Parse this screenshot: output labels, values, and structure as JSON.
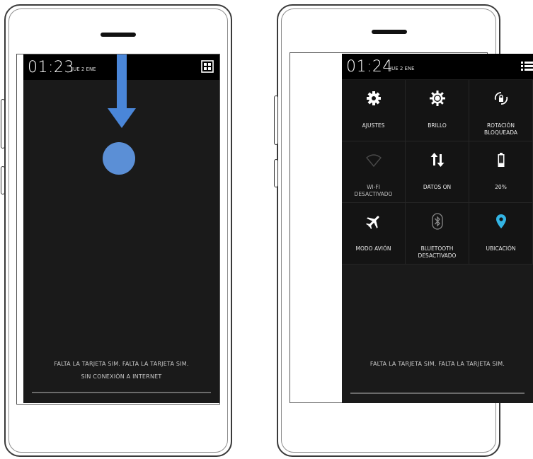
{
  "left_screen": {
    "time": "01:23",
    "date": "JUE 2 ENE",
    "notice_line1": "FALTA LA TARJETA SIM.   FALTA LA TARJETA SIM.",
    "notice_line2": "SIN CONEXIÓN A INTERNET",
    "gesture": "swipe-down"
  },
  "right_screen": {
    "time": "01:24",
    "date": "JUE 2 ENE",
    "notice_line1": "FALTA LA TARJETA SIM.   FALTA LA TARJETA SIM.",
    "quick_settings": [
      {
        "label": "AJUSTES",
        "icon": "settings-gear-icon"
      },
      {
        "label": "BRILLO",
        "icon": "brightness-icon"
      },
      {
        "label": "ROTACIÓN\nBLOQUEADA",
        "icon": "rotation-lock-icon"
      },
      {
        "label": "WI-FI\nDESACTIVADO",
        "icon": "wifi-off-icon"
      },
      {
        "label": "DATOS ON",
        "icon": "data-arrows-icon"
      },
      {
        "label": "20%",
        "icon": "battery-icon"
      },
      {
        "label": "MODO AVIÓN",
        "icon": "airplane-icon"
      },
      {
        "label": "BLUETOOTH\nDESACTIVADO",
        "icon": "bluetooth-icon"
      },
      {
        "label": "UBICACIÓN",
        "icon": "location-pin-icon"
      }
    ]
  },
  "colors": {
    "accent_blue": "#4a86d8",
    "location_blue": "#33b5e5",
    "screen_bg": "#1a1a1a"
  }
}
